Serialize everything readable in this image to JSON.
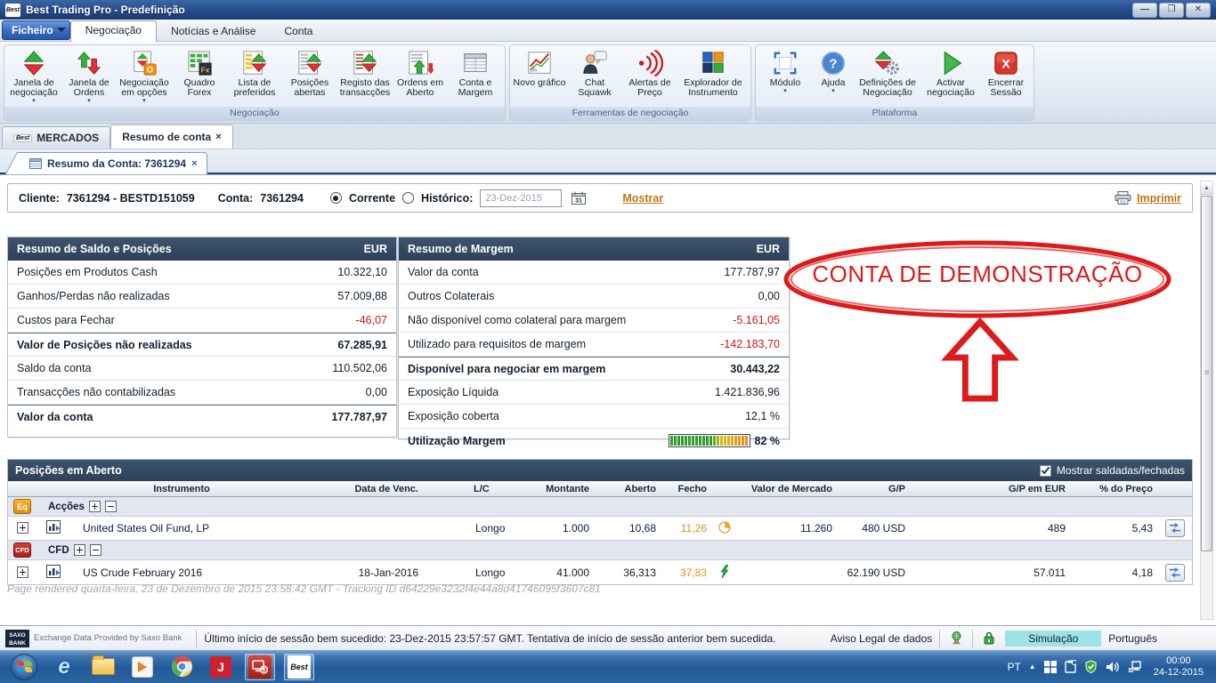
{
  "window": {
    "title": "Best Trading Pro - Predefinição",
    "app_badge": "Best"
  },
  "menu_tabs": {
    "ficheiro": "Ficheiro",
    "negociacao": "Negociação",
    "noticias": "Notícias e Análise",
    "conta": "Conta"
  },
  "ribbon": {
    "caret": "▾",
    "groups": [
      {
        "label": "Negociação",
        "buttons": [
          {
            "label": "Janela de negociação"
          },
          {
            "label": "Janela de Ordens"
          },
          {
            "label": "Negociação em opções"
          },
          {
            "label": "Quadro Forex"
          },
          {
            "label": "Lista de preferidos"
          },
          {
            "label": "Posições abertas"
          },
          {
            "label": "Registo das transacções"
          },
          {
            "label": "Ordens em Aberto"
          },
          {
            "label": "Conta e Margem"
          }
        ]
      },
      {
        "label": "Ferramentas de negociação",
        "buttons": [
          {
            "label": "Novo gráfico"
          },
          {
            "label": "Chat Squawk"
          },
          {
            "label": "Alertas de Preço"
          },
          {
            "label": "Explorador de Instrumento"
          }
        ]
      },
      {
        "label": "Plataforma",
        "buttons": [
          {
            "label": "Módulo"
          },
          {
            "label": "Ajuda"
          },
          {
            "label": "Definições de Negociação"
          },
          {
            "label": "Activar negociação"
          },
          {
            "label": "Encerrar Sessão"
          }
        ]
      }
    ]
  },
  "doc_tabs": {
    "mercados": "MERCADOS",
    "resumo": "Resumo de conta",
    "close": "×"
  },
  "sub_tab": {
    "label": "Resumo da Conta: 7361294",
    "close": "×"
  },
  "client_bar": {
    "cliente_label": "Cliente:",
    "cliente_value": "7361294 - BESTD151059",
    "conta_label": "Conta:",
    "conta_value": "7361294",
    "radio_corrente": "Corrente",
    "radio_historico": "Histórico:",
    "date_value": "23-Dez-2015",
    "mostrar": "Mostrar",
    "imprimir": "Imprimir"
  },
  "balance_panel": {
    "title": "Resumo de Saldo e Posições",
    "currency": "EUR",
    "rows": [
      {
        "label": "Posições em Produtos Cash",
        "value": "10.322,10"
      },
      {
        "label": "Ganhos/Perdas não realizadas",
        "value": "57.009,88"
      },
      {
        "label": "Custos para Fechar",
        "value": "-46,07"
      },
      {
        "label": "Valor de Posições não realizadas",
        "value": "67.285,91"
      },
      {
        "label": "Saldo da conta",
        "value": "110.502,06"
      },
      {
        "label": "Transacções não contabilizadas",
        "value": "0,00"
      },
      {
        "label": "Valor da conta",
        "value": "177.787,97"
      }
    ]
  },
  "margin_panel": {
    "title": "Resumo de Margem",
    "currency": "EUR",
    "rows": [
      {
        "label": "Valor da conta",
        "value": "177.787,97"
      },
      {
        "label": "Outros Colaterais",
        "value": "0,00"
      },
      {
        "label": "Não disponível como colateral para margem",
        "value": "-5.161,05"
      },
      {
        "label": "Utilizado para requisitos de margem",
        "value": "-142.183,70"
      },
      {
        "label": "Disponível para negociar em margem",
        "value": "30.443,22"
      },
      {
        "label": "Exposição Líquida",
        "value": "1.421.836,96"
      },
      {
        "label": "Exposição coberta",
        "value": "12,1 %"
      },
      {
        "label": "Utilização Margem",
        "value": "82 %"
      }
    ]
  },
  "annotation": {
    "text": "CONTA DE DEMONSTRAÇÃO",
    "color": "#dd1b1b"
  },
  "positions": {
    "title": "Posições em Aberto",
    "show_closed_label": "Mostrar saldadas/fechadas",
    "columns": [
      "Instrumento",
      "Data de Venc.",
      "L/C",
      "Montante",
      "Aberto",
      "Fecho",
      "Valor de Mercado",
      "G/P",
      "G/P em EUR",
      "% do Preço"
    ],
    "groups": [
      {
        "badge": "Eq",
        "label": "Acções"
      },
      {
        "badge": "CFD",
        "label": "CFD"
      }
    ],
    "rows": [
      {
        "instrument": "United States Oil Fund, LP",
        "maturity": "",
        "lc": "Longo",
        "amount": "1.000",
        "open": "10,68",
        "close": "11,26",
        "status_icon": "clock",
        "market_value": "11.260",
        "gp": "480 USD",
        "gp_eur": "489",
        "pct": "5,43"
      },
      {
        "instrument": "US Crude February 2016",
        "maturity": "18-Jan-2016",
        "lc": "Longo",
        "amount": "41.000",
        "open": "36,313",
        "close": "37,83",
        "status_icon": "lightning",
        "market_value": "",
        "gp": "62.190 USD",
        "gp_eur": "57.011",
        "pct": "4,18"
      }
    ]
  },
  "footer": {
    "note": "Page rendered quarta-feira, 23 de Dezembro de 2015 23:58:42 GMT - Tracking ID d64229e3232f4e44a8d41746095f3607c81"
  },
  "status_bar": {
    "logo_top": "SAXO",
    "logo_bottom": "BANK",
    "provider": "Exchange Data Provided by Saxo Bank",
    "session": "Último início de sessão bem sucedido: 23-Dez-2015 23:57:57 GMT. Tentativa de início de sessão anterior bem sucedida.",
    "legal": "Aviso Legal de dados",
    "mode": "Simulação",
    "language": "Português"
  },
  "taskbar": {
    "lang": "PT",
    "j_label": "J",
    "best_label": "Best",
    "clock_time": "00:00",
    "clock_date": "24-12-2015"
  },
  "colors": {
    "header_navy": "#344860",
    "negative_red": "#d21414",
    "close_orange": "#e09018",
    "annotation_red": "#dd1b1b",
    "simulation_cyan": "#9de2e6",
    "link_orange": "#c0761a"
  }
}
